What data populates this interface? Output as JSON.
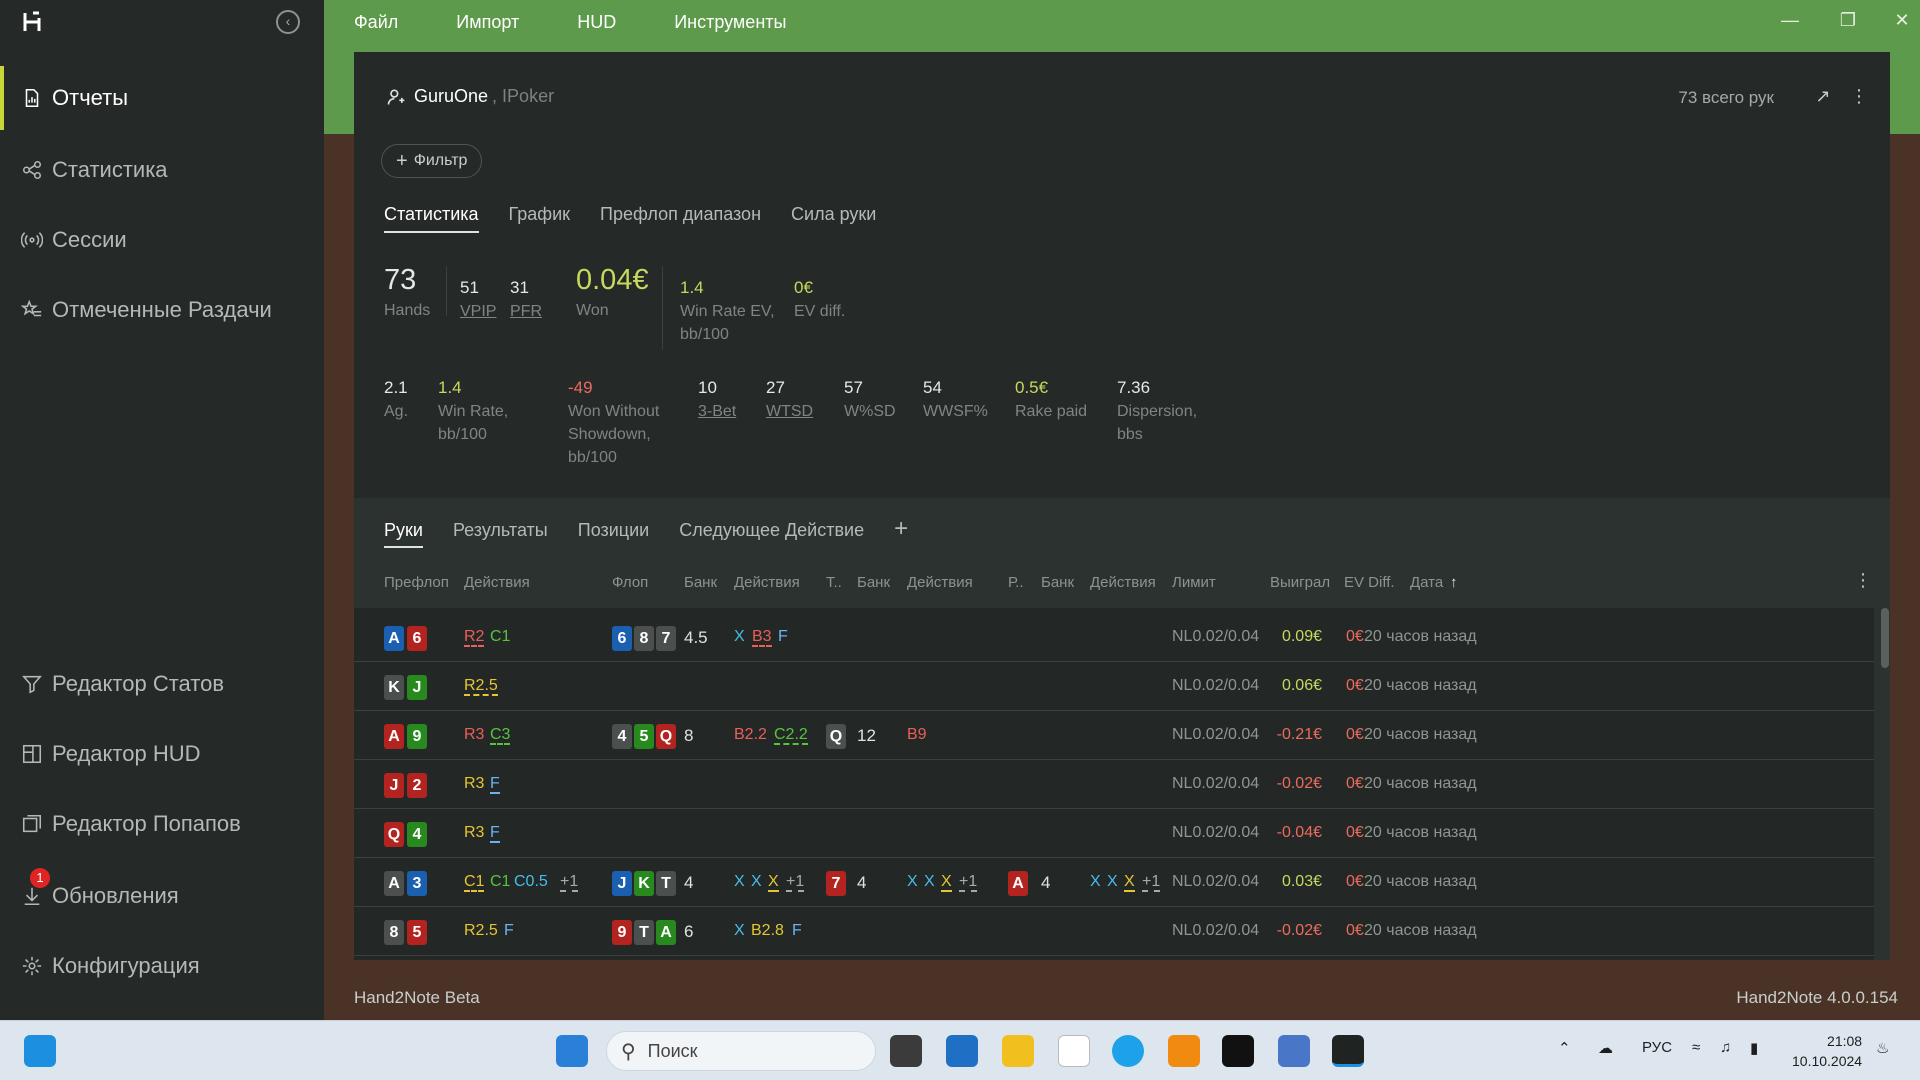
{
  "sidebar": {
    "items": [
      {
        "label": "Отчеты",
        "icon": "report-icon"
      },
      {
        "label": "Статистика",
        "icon": "share-nodes-icon"
      },
      {
        "label": "Сессии",
        "icon": "broadcast-icon"
      },
      {
        "label": "Отмеченные Раздачи",
        "icon": "star-list-icon"
      }
    ],
    "bottom_items": [
      {
        "label": "Редактор Статов",
        "icon": "filter-icon"
      },
      {
        "label": "Редактор HUD",
        "icon": "hud-icon"
      },
      {
        "label": "Редактор Попапов",
        "icon": "popup-icon"
      },
      {
        "label": "Обновления",
        "icon": "download-icon",
        "badge": "1"
      },
      {
        "label": "Конфигурация",
        "icon": "gear-icon"
      }
    ]
  },
  "menu": {
    "items": [
      "Файл",
      "Импорт",
      "HUD",
      "Инструменты"
    ]
  },
  "header": {
    "user": "GuruOne",
    "room": ", IPoker",
    "total_hands": "73 всего рук"
  },
  "filter_label": "Фильтр",
  "tabs": [
    "Статистика",
    "График",
    "Префлоп диапазон",
    "Сила руки"
  ],
  "stats_top": {
    "hands": {
      "value": "73",
      "label": "Hands"
    },
    "vpip": {
      "value": "51",
      "label": "VPIP"
    },
    "pfr": {
      "value": "31",
      "label": "PFR"
    },
    "won": {
      "value": "0.04€",
      "label": "Won"
    },
    "winrate_ev": {
      "value": "1.4",
      "label1": "Win Rate EV,",
      "label2": "bb/100"
    },
    "ev_diff": {
      "value": "0€",
      "label": "EV diff."
    }
  },
  "stats_bottom": {
    "ag": {
      "value": "2.1",
      "label": "Ag."
    },
    "winrate": {
      "value": "1.4",
      "label1": "Win Rate,",
      "label2": "bb/100"
    },
    "wws": {
      "value": "-49",
      "label1": "Won Without",
      "label2": "Showdown,",
      "label3": "bb/100"
    },
    "threebet": {
      "value": "10",
      "label": "3-Bet"
    },
    "wtsd": {
      "value": "27",
      "label": "WTSD"
    },
    "wsd": {
      "value": "57",
      "label": "W%SD"
    },
    "wwsf": {
      "value": "54",
      "label": "WWSF%"
    },
    "rake": {
      "value": "0.5€",
      "label": "Rake paid"
    },
    "dispersion": {
      "value": "7.36",
      "label1": "Dispersion,",
      "label2": "bbs"
    }
  },
  "subtabs": [
    "Руки",
    "Результаты",
    "Позиции",
    "Следующее Действие"
  ],
  "columns": {
    "preflop": "Префлоп",
    "actions1": "Действия",
    "flop": "Флоп",
    "bank1": "Банк",
    "actions2": "Действия",
    "turn": "Т..",
    "bank2": "Банк",
    "actions3": "Действия",
    "river": "Р..",
    "bank3": "Банк",
    "actions4": "Действия",
    "limit": "Лимит",
    "won": "Выиграл",
    "evdiff": "EV Diff.",
    "date": "Дата"
  },
  "rows": [
    {
      "c1": "A",
      "c2": "6",
      "pf1": "R2",
      "pf2": "C1",
      "flop": [
        "6",
        "8",
        "7"
      ],
      "bank": "4.5",
      "fa1": "X",
      "fa2": "B3",
      "fa3": "F",
      "limit": "NL0.02/0.04",
      "won": "0.09€",
      "ev": "0€",
      "date": "20 часов назад"
    },
    {
      "c1": "K",
      "c2": "J",
      "pf1": "R2.5",
      "limit": "NL0.02/0.04",
      "won": "0.06€",
      "ev": "0€",
      "date": "20 часов назад"
    },
    {
      "c1": "A",
      "c2": "9",
      "pf1": "R3",
      "pf2": "C3",
      "flop": [
        "4",
        "5",
        "Q"
      ],
      "bank": "8",
      "fa1": "B2.2",
      "fa2": "C2.2",
      "turn": "Q",
      "bank2": "12",
      "ta1": "B9",
      "limit": "NL0.02/0.04",
      "won": "-0.21€",
      "ev": "0€",
      "date": "20 часов назад"
    },
    {
      "c1": "J",
      "c2": "2",
      "pf1": "R3",
      "pf2": "F",
      "limit": "NL0.02/0.04",
      "won": "-0.02€",
      "ev": "0€",
      "date": "20 часов назад"
    },
    {
      "c1": "Q",
      "c2": "4",
      "pf1": "R3",
      "pf2": "F",
      "limit": "NL0.02/0.04",
      "won": "-0.04€",
      "ev": "0€",
      "date": "20 часов назад"
    },
    {
      "c1": "A",
      "c2": "3",
      "pf1": "C1",
      "pf2": "C1",
      "pf3": "C0.5",
      "pf4": "+1",
      "flop": [
        "J",
        "K",
        "T"
      ],
      "bank": "4",
      "fa1": "X",
      "fa2": "X",
      "fa3": "X",
      "fa4": "+1",
      "turn": "7",
      "bank2": "4",
      "ta1": "X",
      "ta2": "X",
      "ta3": "X",
      "ta4": "+1",
      "river": "A",
      "bank3": "4",
      "ra1": "X",
      "ra2": "X",
      "ra3": "X",
      "ra4": "+1",
      "limit": "NL0.02/0.04",
      "won": "0.03€",
      "ev": "0€",
      "date": "20 часов назад"
    },
    {
      "c1": "8",
      "c2": "5",
      "pf1": "R2.5",
      "pf2": "F",
      "flop": [
        "9",
        "T",
        "A"
      ],
      "bank": "6",
      "fa1": "X",
      "fa2": "B2.8",
      "fa3": "F",
      "limit": "NL0.02/0.04",
      "won": "-0.02€",
      "ev": "0€",
      "date": "20 часов назад"
    }
  ],
  "status": {
    "left": "Hand2Note Beta",
    "right": "Hand2Note 4.0.0.154"
  },
  "taskbar": {
    "search": "Поиск",
    "lang": "РУС",
    "time": "21:08",
    "date": "10.10.2024"
  }
}
